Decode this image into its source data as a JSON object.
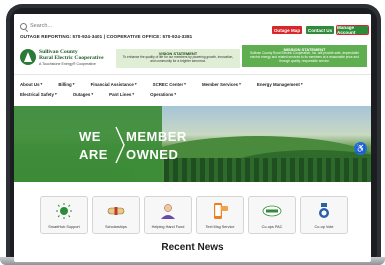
{
  "topbar": {
    "search_placeholder": "Search...",
    "outage_line": "OUTAGE REPORTING: 570-924-3401 | COOPERATIVE OFFICE: 570-924-3381",
    "buttons": {
      "outage_map": "Outage Map",
      "contact_us": "Contact Us",
      "manage_account": "Manage Account"
    }
  },
  "header": {
    "logo_name_line1": "Sullivan County",
    "logo_name_line2": "Rural Electric Cooperative",
    "logo_tagline": "A Touchstone Energy® Cooperative",
    "vision": {
      "title": "VISION STATEMENT",
      "text": "To enhance the quality of life for our members by powering growth, innovation, and community for a brighter tomorrow."
    },
    "mission": {
      "title": "MISSION STATEMENT",
      "text": "Sullivan County Rural Electric Cooperative, Inc. will provide safe, dependable electric energy and related services to its members at a reasonable price and through quality, responsible service."
    }
  },
  "nav": {
    "items": [
      "About Us",
      "Billing",
      "Financial Assistance",
      "SCREC Center",
      "Member Services",
      "Energy Management",
      "Electrical Safety",
      "Outages",
      "Pant Lines",
      "Operations"
    ]
  },
  "hero": {
    "word_we": "WE",
    "word_are": "ARE",
    "word_member": "MEMBER",
    "word_owned": "OWNED"
  },
  "quick_links": [
    {
      "label": "SmartHub Support",
      "icon": "smarthub-icon"
    },
    {
      "label": "Scholarships",
      "icon": "diploma-icon"
    },
    {
      "label": "Helping Hand Fund",
      "icon": "helping-hand-icon"
    },
    {
      "label": "Text Msg Service",
      "icon": "phone-icon"
    },
    {
      "label": "Co-ops PAC",
      "icon": "co-ops-pac-icon"
    },
    {
      "label": "Co-op Vote",
      "icon": "vote-icon"
    }
  ],
  "news": {
    "title": "Recent News"
  },
  "colors": {
    "brand_green": "#2e8b3a",
    "alert_red": "#d9262b",
    "hero_green": "#3c8c37",
    "accessibility_blue": "#1f6ed4"
  }
}
